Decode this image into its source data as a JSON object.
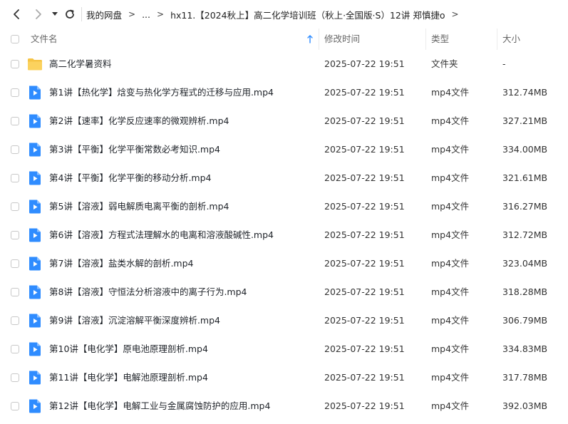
{
  "breadcrumb": {
    "root": "我的网盘",
    "ellipsis": "...",
    "current": "hx11.【2024秋上】高二化学培训班（秋上·全国版·S）12讲 郑慎捷o"
  },
  "columns": {
    "name": "文件名",
    "modified": "修改时间",
    "type": "类型",
    "size": "大小"
  },
  "files": [
    {
      "name": "高二化学暑资料",
      "modified": "2025-07-22 19:51",
      "type": "文件夹",
      "size": "-",
      "kind": "folder"
    },
    {
      "name": "第1讲【热化学】焓变与热化学方程式的迁移与应用.mp4",
      "modified": "2025-07-22 19:51",
      "type": "mp4文件",
      "size": "312.74MB",
      "kind": "video"
    },
    {
      "name": "第2讲【速率】化学反应速率的微观辨析.mp4",
      "modified": "2025-07-22 19:51",
      "type": "mp4文件",
      "size": "327.21MB",
      "kind": "video"
    },
    {
      "name": "第3讲【平衡】化学平衡常数必考知识.mp4",
      "modified": "2025-07-22 19:51",
      "type": "mp4文件",
      "size": "334.00MB",
      "kind": "video"
    },
    {
      "name": "第4讲【平衡】化学平衡的移动分析.mp4",
      "modified": "2025-07-22 19:51",
      "type": "mp4文件",
      "size": "321.61MB",
      "kind": "video"
    },
    {
      "name": "第5讲【溶液】弱电解质电离平衡的剖析.mp4",
      "modified": "2025-07-22 19:51",
      "type": "mp4文件",
      "size": "316.27MB",
      "kind": "video"
    },
    {
      "name": "第6讲【溶液】方程式法理解水的电离和溶液酸碱性.mp4",
      "modified": "2025-07-22 19:51",
      "type": "mp4文件",
      "size": "312.72MB",
      "kind": "video"
    },
    {
      "name": "第7讲【溶液】盐类水解的剖析.mp4",
      "modified": "2025-07-22 19:51",
      "type": "mp4文件",
      "size": "323.04MB",
      "kind": "video"
    },
    {
      "name": "第8讲【溶液】守恒法分析溶液中的离子行为.mp4",
      "modified": "2025-07-22 19:51",
      "type": "mp4文件",
      "size": "318.28MB",
      "kind": "video"
    },
    {
      "name": "第9讲【溶液】沉淀溶解平衡深度辨析.mp4",
      "modified": "2025-07-22 19:51",
      "type": "mp4文件",
      "size": "306.79MB",
      "kind": "video"
    },
    {
      "name": "第10讲【电化学】原电池原理剖析.mp4",
      "modified": "2025-07-22 19:51",
      "type": "mp4文件",
      "size": "334.83MB",
      "kind": "video"
    },
    {
      "name": "第11讲【电化学】电解池原理剖析.mp4",
      "modified": "2025-07-22 19:51",
      "type": "mp4文件",
      "size": "317.78MB",
      "kind": "video"
    },
    {
      "name": "第12讲【电化学】电解工业与金属腐蚀防护的应用.mp4",
      "modified": "2025-07-22 19:51",
      "type": "mp4文件",
      "size": "392.03MB",
      "kind": "video"
    }
  ],
  "icons": {
    "back": "chevron-left-icon",
    "forward": "chevron-right-icon",
    "history": "caret-down-icon",
    "refresh": "refresh-icon",
    "sort": "sort-arrow-up-icon",
    "folder": "folder-icon",
    "video": "video-file-icon"
  },
  "colors": {
    "folder": "#f6c445",
    "video": "#2f8cff",
    "sort_arrow": "#2f8cff"
  }
}
